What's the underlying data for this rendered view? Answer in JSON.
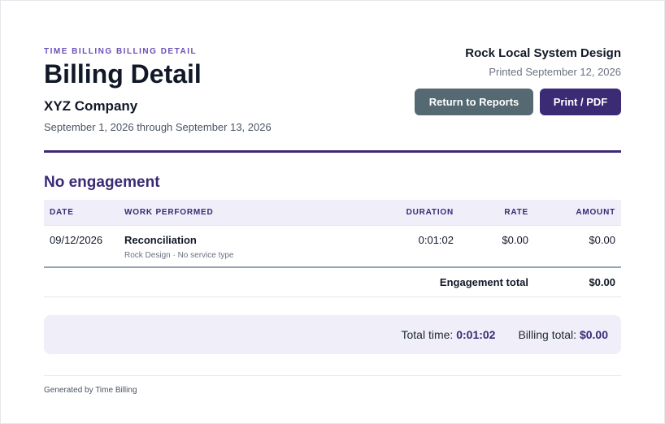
{
  "header": {
    "kicker": "TIME BILLING BILLING DETAIL",
    "title": "Billing Detail",
    "company": "XYZ Company",
    "date_range": "September 1, 2026 through September 13, 2026",
    "firm": "Rock Local System Design",
    "printed": "Printed September 12, 2026",
    "return_label": "Return to Reports",
    "print_label": "Print / PDF"
  },
  "colors": {
    "accent": "#3b2a74",
    "kicker": "#6b4fb5",
    "secondary_button": "#546972",
    "table_header_bg": "#f0eef9"
  },
  "section": {
    "title": "No engagement",
    "columns": {
      "date": "DATE",
      "work": "WORK PERFORMED",
      "duration": "DURATION",
      "rate": "RATE",
      "amount": "AMOUNT"
    },
    "rows": [
      {
        "date": "09/12/2026",
        "work": "Reconciliation",
        "sub": "Rock Design · No service type",
        "duration": "0:01:02",
        "rate": "$0.00",
        "amount": "$0.00"
      }
    ],
    "total_label": "Engagement total",
    "total_amount": "$0.00"
  },
  "summary": {
    "time_label": "Total time:",
    "time_value": "0:01:02",
    "billing_label": "Billing total:",
    "billing_value": "$0.00"
  },
  "footer": {
    "text": "Generated by Time Billing"
  }
}
